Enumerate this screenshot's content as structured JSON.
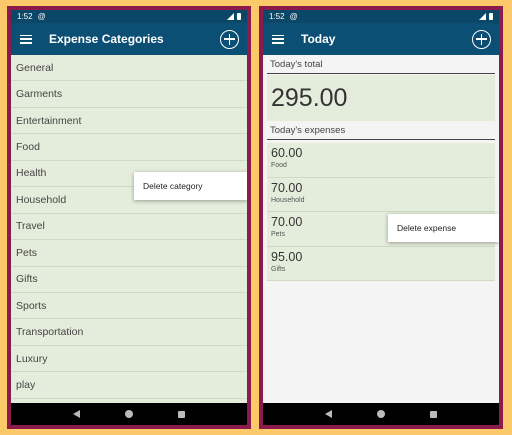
{
  "left": {
    "status": {
      "time": "1:52",
      "notif_icon": "@"
    },
    "appbar": {
      "title": "Expense Categories"
    },
    "categories": [
      "General",
      "Garments",
      "Entertainment",
      "Food",
      "Health",
      "Household",
      "Travel",
      "Pets",
      "Gifts",
      "Sports",
      "Transportation",
      "Luxury",
      "play"
    ],
    "popup": {
      "label": "Delete category"
    }
  },
  "right": {
    "status": {
      "time": "1:52",
      "notif_icon": "@"
    },
    "appbar": {
      "title": "Today"
    },
    "total_label": "Today's total",
    "total_value": "295.00",
    "expenses_label": "Today's expenses",
    "expenses": [
      {
        "amount": "60.00",
        "category": "Food"
      },
      {
        "amount": "70.00",
        "category": "Household"
      },
      {
        "amount": "70.00",
        "category": "Pets"
      },
      {
        "amount": "95.00",
        "category": "Gifts"
      }
    ],
    "popup": {
      "label": "Delete expense"
    }
  },
  "colors": {
    "background": "#fcc96a",
    "phone_frame": "#8a1b4a",
    "appbar": "#0b4f74",
    "list_bg": "#e4ecdb"
  }
}
